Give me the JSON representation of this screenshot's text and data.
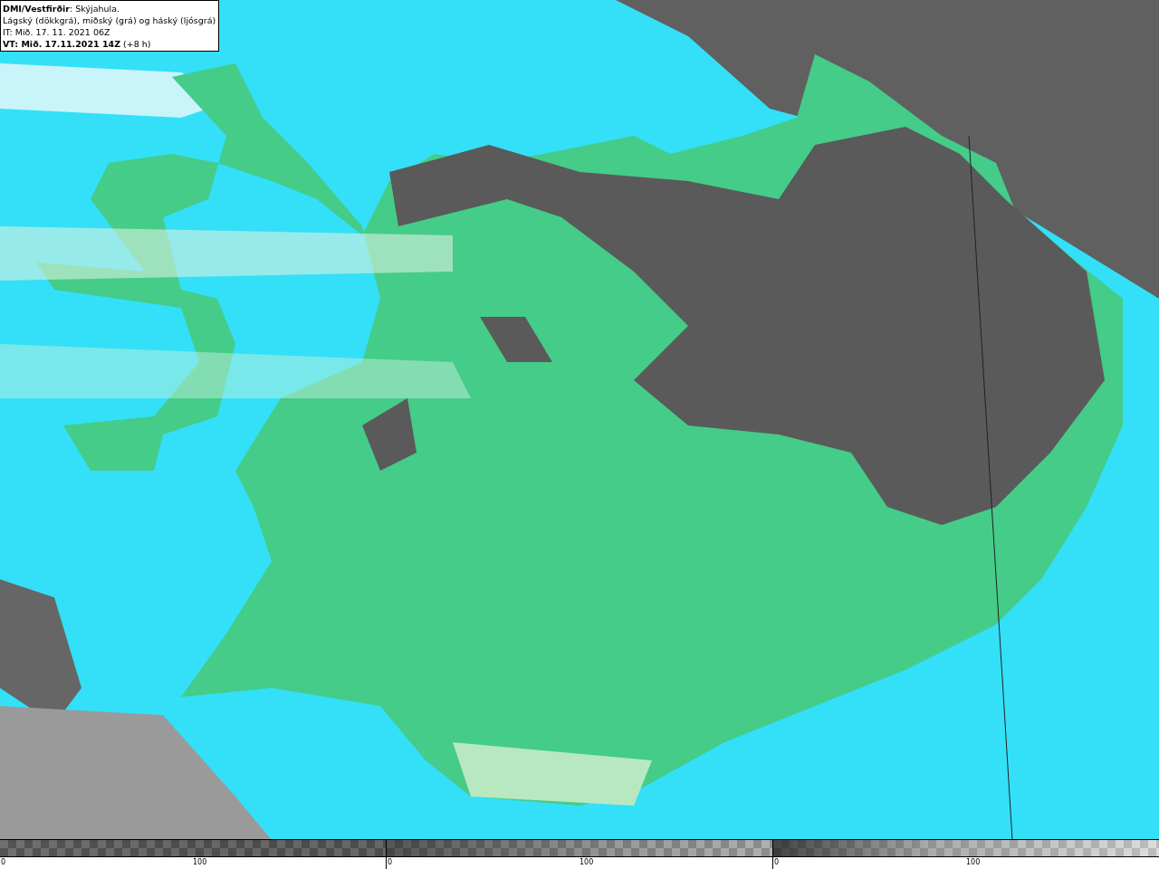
{
  "info_box": {
    "lines": [
      "**DMI/Vestfirðir**: Skýjahula.",
      "Lágský (dökkgrá), miðský (grá) og háský (ljósgrá)",
      "IT: Mið. 17. 11. 2021 06Z",
      "**VT: Mið. 17.11.2021 14Z** (+8 h)"
    ]
  },
  "legend": [
    {
      "kind": "low",
      "min_label": "0",
      "mid_label": "100"
    },
    {
      "kind": "mid",
      "min_label": "0",
      "mid_label": "100"
    },
    {
      "kind": "high",
      "min_label": "0",
      "mid_label": "100"
    }
  ]
}
